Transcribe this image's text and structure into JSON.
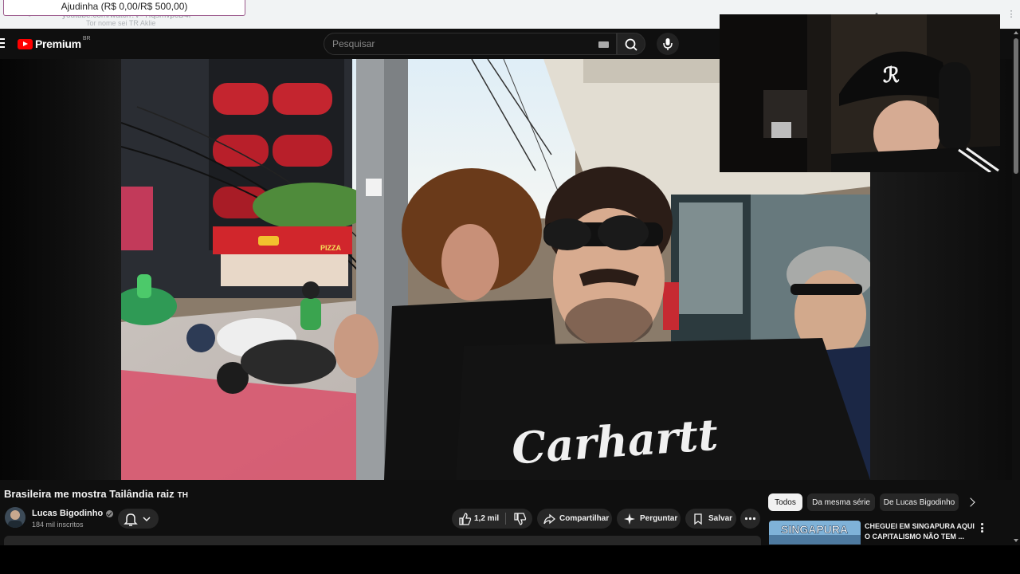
{
  "browser": {
    "url_fragment": "youtube.com/watch?v=TIqsmvpcD4I",
    "ghost_text": "Tor nome sei TR Aklie",
    "donation_overlay": "Ajudinha (R$ 0,00/R$ 500,00)"
  },
  "masthead": {
    "logo_text": "Premium",
    "logo_region": "BR",
    "search_placeholder": "Pesquisar"
  },
  "video": {
    "title": "Brasileira me mostra Tailândia raiz",
    "title_suffix": "TH",
    "shirt_text": "Carhartt",
    "stall_sign": "PIZZA"
  },
  "channel": {
    "name": "Lucas Bigodinho",
    "subscribers": "184 mil inscritos"
  },
  "actions": {
    "likes": "1,2 mil",
    "share": "Compartilhar",
    "ask": "Perguntar",
    "save": "Salvar"
  },
  "chips": [
    {
      "label": "Todos",
      "selected": true
    },
    {
      "label": "Da mesma série",
      "selected": false
    },
    {
      "label": "De Lucas Bigodinho",
      "selected": false
    }
  ],
  "recommendation": {
    "thumbnail_text": "SINGAPURA",
    "title": "CHEGUEI EM SINGAPURA AQUI O CAPITALISMO NÃO TEM ..."
  },
  "colors": {
    "brand_red": "#ff0000",
    "bg": "#0f0f0f",
    "pill": "#272727"
  },
  "icons": [
    "menu-icon",
    "youtube-logo-icon",
    "keyboard-icon",
    "search-icon",
    "mic-icon",
    "bell-icon",
    "chevron-down-icon",
    "like-icon",
    "dislike-icon",
    "share-icon",
    "sparkle-icon",
    "save-icon",
    "more-icon",
    "chevron-right-icon",
    "verified-icon",
    "kebab-icon"
  ]
}
